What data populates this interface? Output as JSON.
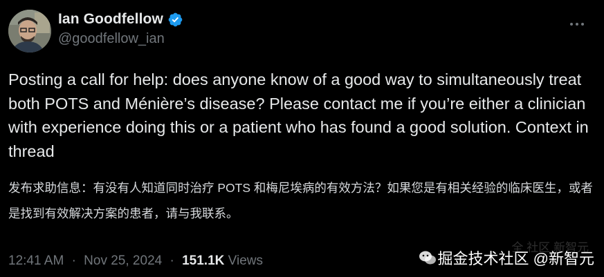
{
  "author": {
    "name": "Ian Goodfellow",
    "handle": "@goodfellow_ian",
    "verified": true
  },
  "tweet": {
    "text": "Posting a call for help: does anyone know of a good way to simultaneously treat both POTS and Ménière’s disease? Please contact me if you’re either a clinician with experience doing this or a patient who has found a good solution. Context in thread",
    "translation": "发布求助信息：有没有人知道同时治疗 POTS 和梅尼埃病的有效方法？如果您是有相关经验的临床医生，或者是找到有效解决方案的患者，请与我联系。"
  },
  "meta": {
    "time": "12:41 AM",
    "separator": "·",
    "date": "Nov 25, 2024",
    "views_count": "151.1K",
    "views_label": "Views"
  },
  "watermark": {
    "text": "掘金技术社区 @新智元",
    "ghost": "全 社区  新智元"
  },
  "colors": {
    "background": "#000000",
    "primary_text": "#e7e9ea",
    "secondary_text": "#71767b",
    "verified_badge": "#1d9bf0"
  },
  "icons": {
    "verified": "verified-badge-icon",
    "more": "more-options-icon",
    "watermark_logo": "wechat-logo-icon"
  }
}
